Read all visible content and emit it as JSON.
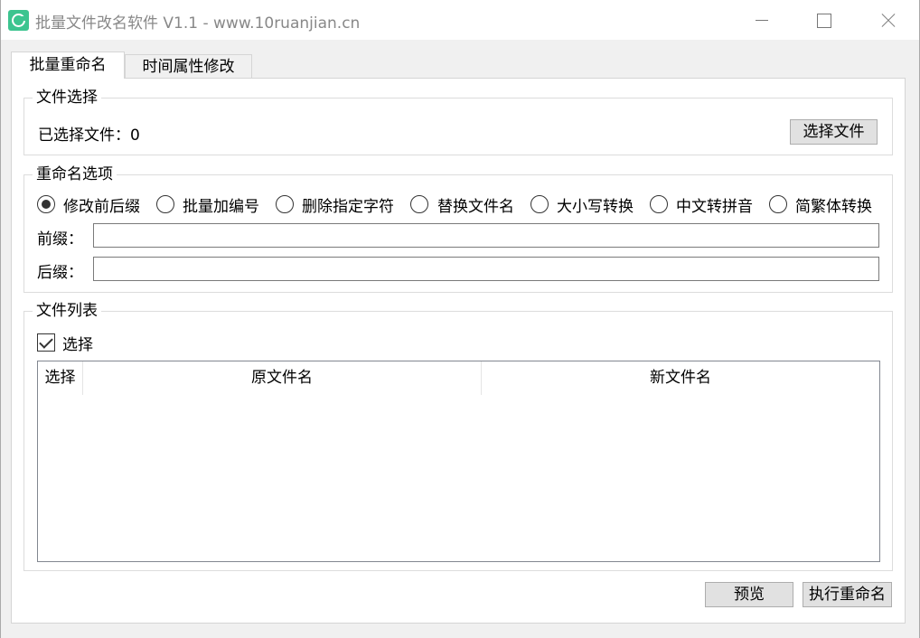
{
  "window": {
    "title": "批量文件改名软件 V1.1 - www.10ruanjian.cn",
    "accent": "#3cc48f"
  },
  "tabs": [
    {
      "label": "批量重命名",
      "active": true
    },
    {
      "label": "时间属性修改",
      "active": false
    }
  ],
  "file_select": {
    "legend": "文件选择",
    "selected_label": "已选择文件：",
    "selected_count": "0",
    "choose_button": "选择文件"
  },
  "rename_options": {
    "legend": "重命名选项",
    "modes": [
      {
        "label": "修改前后缀",
        "checked": true
      },
      {
        "label": "批量加编号",
        "checked": false
      },
      {
        "label": "删除指定字符",
        "checked": false
      },
      {
        "label": "替换文件名",
        "checked": false
      },
      {
        "label": "大小写转换",
        "checked": false
      },
      {
        "label": "中文转拼音",
        "checked": false
      },
      {
        "label": "简繁体转换",
        "checked": false
      }
    ],
    "prefix_label": "前缀：",
    "prefix_value": "",
    "suffix_label": "后缀：",
    "suffix_value": ""
  },
  "file_list": {
    "legend": "文件列表",
    "select_all_label": "选择",
    "select_all_checked": true,
    "columns": [
      "选择",
      "原文件名",
      "新文件名"
    ],
    "rows": []
  },
  "actions": {
    "preview_button": "预览",
    "execute_button": "执行重命名"
  }
}
